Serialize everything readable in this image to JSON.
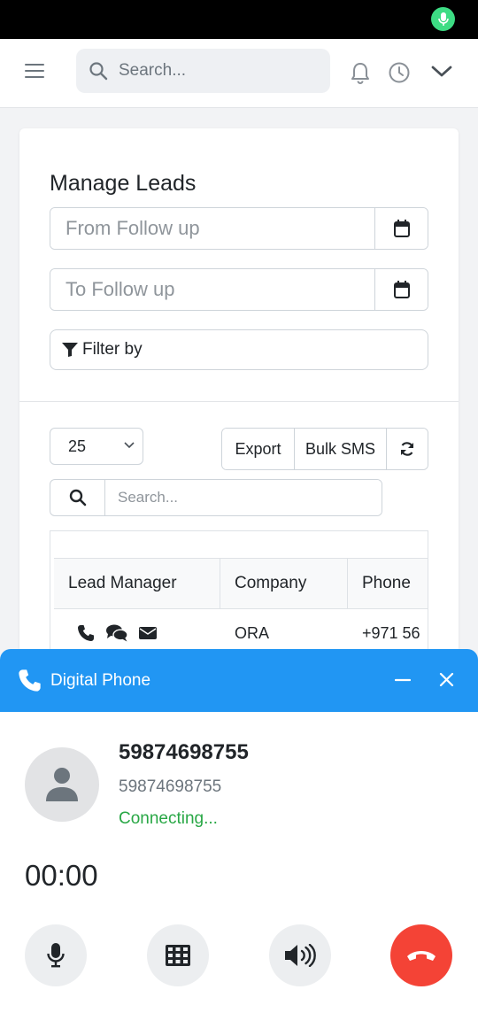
{
  "topbar": {
    "search_placeholder": "Search..."
  },
  "leads": {
    "title": "Manage Leads",
    "from_placeholder": "From Follow up",
    "to_placeholder": "To Follow up",
    "filter_label": "Filter by",
    "page_size": "25",
    "export_label": "Export",
    "bulk_sms_label": "Bulk SMS",
    "table_search_placeholder": "Search...",
    "columns": [
      "Lead Manager",
      "Company",
      "Phone"
    ],
    "rows": [
      {
        "company": "ORA",
        "phone": "+971 56"
      }
    ]
  },
  "phone": {
    "title": "Digital Phone",
    "callee_name": "59874698755",
    "callee_number": "59874698755",
    "status": "Connecting...",
    "timer": "00:00"
  },
  "colors": {
    "accent": "#2196f3",
    "status_ok": "#28a745",
    "hangup": "#f44336",
    "mic_indicator": "#3ddc84"
  },
  "icons": {
    "status_mic": "mic-icon",
    "menu": "hamburger-icon",
    "search": "search-icon",
    "notifications": "bell-icon",
    "history": "clock-icon",
    "expand": "chevron-down-icon",
    "calendar": "calendar-icon",
    "filter": "funnel-icon",
    "refresh": "refresh-icon",
    "phone": "phone-icon",
    "chat": "chat-icon",
    "email": "envelope-icon",
    "minimize": "minus-icon",
    "close": "close-icon",
    "avatar": "user-icon",
    "mute": "mic-icon",
    "keypad": "keypad-icon",
    "speaker": "speaker-icon",
    "hangup": "hangup-icon"
  }
}
